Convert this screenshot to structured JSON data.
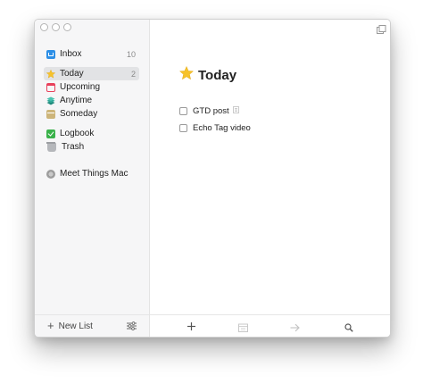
{
  "sidebar": {
    "items": [
      {
        "label": "Inbox",
        "count": "10",
        "icon": "inbox-tray-icon",
        "color": "#2d8fe6"
      },
      {
        "label": "Today",
        "count": "2",
        "icon": "star-icon",
        "color": "#f6c22b",
        "selected": true
      },
      {
        "label": "Upcoming",
        "icon": "calendar-icon",
        "color": "#e8405b"
      },
      {
        "label": "Anytime",
        "icon": "layers-icon",
        "color": "#2fa897"
      },
      {
        "label": "Someday",
        "icon": "archive-box-icon",
        "color": "#cdb57a"
      },
      {
        "label": "Logbook",
        "icon": "logbook-check-icon",
        "color": "#3ab24a"
      },
      {
        "label": "Trash",
        "icon": "trash-icon",
        "color": "#b5b7bb"
      },
      {
        "label": "Meet Things Mac",
        "icon": "project-circle-icon",
        "color": "#9d9d9d"
      }
    ],
    "new_list_label": "New List"
  },
  "main": {
    "title": "Today",
    "title_icon": "star-icon",
    "tasks": [
      {
        "label": "GTD post",
        "has_notes": true
      },
      {
        "label": "Echo Tag video",
        "has_notes": false
      }
    ]
  },
  "toolbar": {
    "buttons": [
      "add-icon",
      "calendar-icon",
      "move-arrow-icon",
      "search-icon"
    ]
  }
}
